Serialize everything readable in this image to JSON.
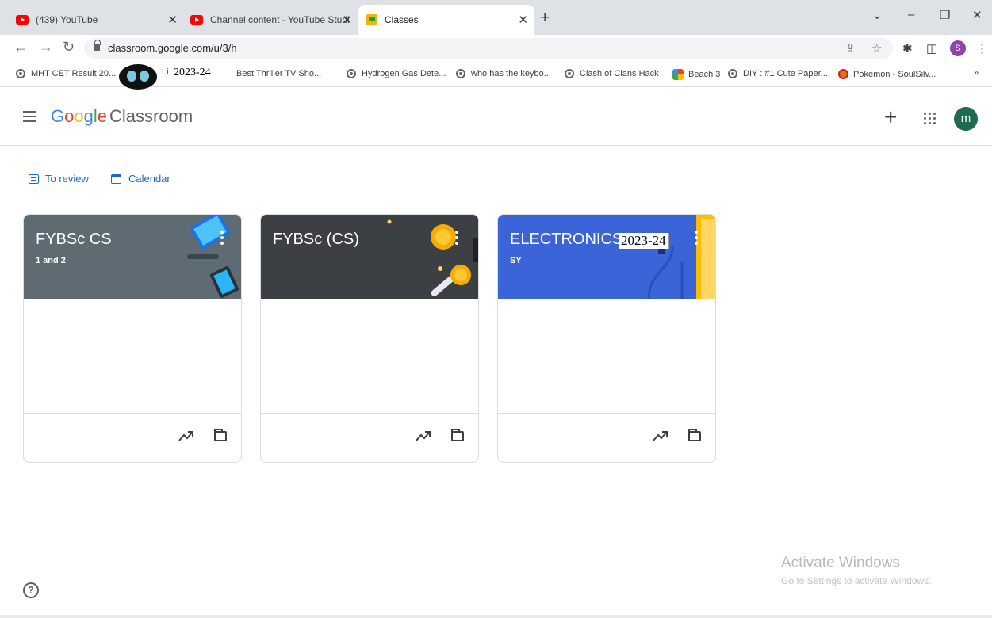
{
  "browser": {
    "tabs": [
      {
        "title": "(439) YouTube",
        "favicon": "youtube-icon"
      },
      {
        "title": "Channel content - YouTube Studi",
        "favicon": "youtube-studio-icon"
      },
      {
        "title": "Classes",
        "favicon": "classroom-icon",
        "active": true
      }
    ],
    "url": "classroom.google.com/u/3/h",
    "profile_initial": "S",
    "bookmarks": [
      {
        "label": "MHT CET Result 20...",
        "icon": "globe-icon"
      },
      {
        "label": "Li",
        "icon": "mascot-icon"
      },
      {
        "label": "Best Thriller TV Sho...",
        "icon": "globe-icon"
      },
      {
        "label": "Hydrogen Gas Dete...",
        "icon": "globe-icon"
      },
      {
        "label": "who has the keybo...",
        "icon": "globe-icon"
      },
      {
        "label": "Clash of Clans Hack",
        "icon": "globe-icon"
      },
      {
        "label": "Beach 3",
        "icon": "pinwheel-icon"
      },
      {
        "label": "DIY : #1 Cute Paper...",
        "icon": "globe-icon"
      },
      {
        "label": "Pokemon - SoulSilv...",
        "icon": "pokemon-icon"
      }
    ],
    "overlay_year": "2023-24",
    "more_bookmarks": "»"
  },
  "app": {
    "brand_letters": [
      "G",
      "o",
      "o",
      "g",
      "l",
      "e"
    ],
    "brand_suffix": "Classroom",
    "avatar_initial": "m",
    "add_symbol": "+"
  },
  "subnav": {
    "to_review": "To review",
    "calendar": "Calendar"
  },
  "classes": [
    {
      "name": "FYBSc CS",
      "section": "1 and 2",
      "color": "#5f6b73"
    },
    {
      "name": "FYBSc (CS)",
      "section": "",
      "color": "#3c4043"
    },
    {
      "name": "ELECTRONICS",
      "section": "SY",
      "color": "#3a64d8",
      "overlay_year": "2023-24"
    }
  ],
  "watermark": {
    "title": "Activate Windows",
    "subtitle": "Go to Settings to activate Windows."
  },
  "help_symbol": "?"
}
